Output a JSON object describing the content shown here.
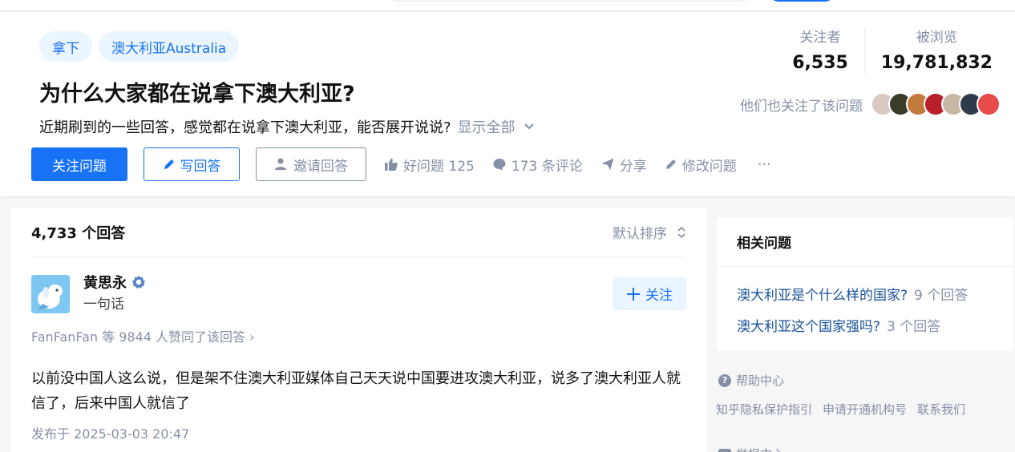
{
  "topics": [
    "拿下",
    "澳大利亚Australia"
  ],
  "question": {
    "title": "为什么大家都在说拿下澳大利亚?",
    "detail": "近期刷到的一些回答，感觉都在说拿下澳大利亚，能否展开说说?",
    "show_all": "显示全部"
  },
  "stats": {
    "followers_label": "关注者",
    "followers_value": "6,535",
    "views_label": "被浏览",
    "views_value": "19,781,832"
  },
  "also_follow_label": "他们也关注了该问题",
  "actions": {
    "follow_question": "关注问题",
    "write_answer": "写回答",
    "invite_answer": "邀请回答",
    "good_question": "好问题 125",
    "comments": "173 条评论",
    "share": "分享",
    "edit": "修改问题",
    "more": "···"
  },
  "answers": {
    "count": "4,733 个回答",
    "sort": "默认排序",
    "first": {
      "author": "黄思永",
      "bio": "一句话",
      "follow": "关注",
      "voters": "FanFanFan 等 9844 人赞同了该回答 ›",
      "content": "以前没中国人这么说，但是架不住澳大利亚媒体自己天天说中国要进攻澳大利亚，说多了澳大利亚人就信了，后来中国人就信了",
      "published": "发布于 2025-03-03 20:47"
    }
  },
  "related": {
    "title": "相关问题",
    "items": [
      {
        "q": "澳大利亚是个什么样的国家?",
        "count": "9 个回答"
      },
      {
        "q": "澳大利亚这个国家强吗?",
        "count": "3 个回答"
      }
    ]
  },
  "footer": {
    "help": "帮助中心",
    "links": [
      "知乎隐私保护指引",
      "申请开通机构号",
      "联系我们"
    ],
    "cut_text": "举报中心"
  },
  "colors": {
    "brand": "#1772f6",
    "muted": "#8590a6",
    "link": "#175199"
  }
}
